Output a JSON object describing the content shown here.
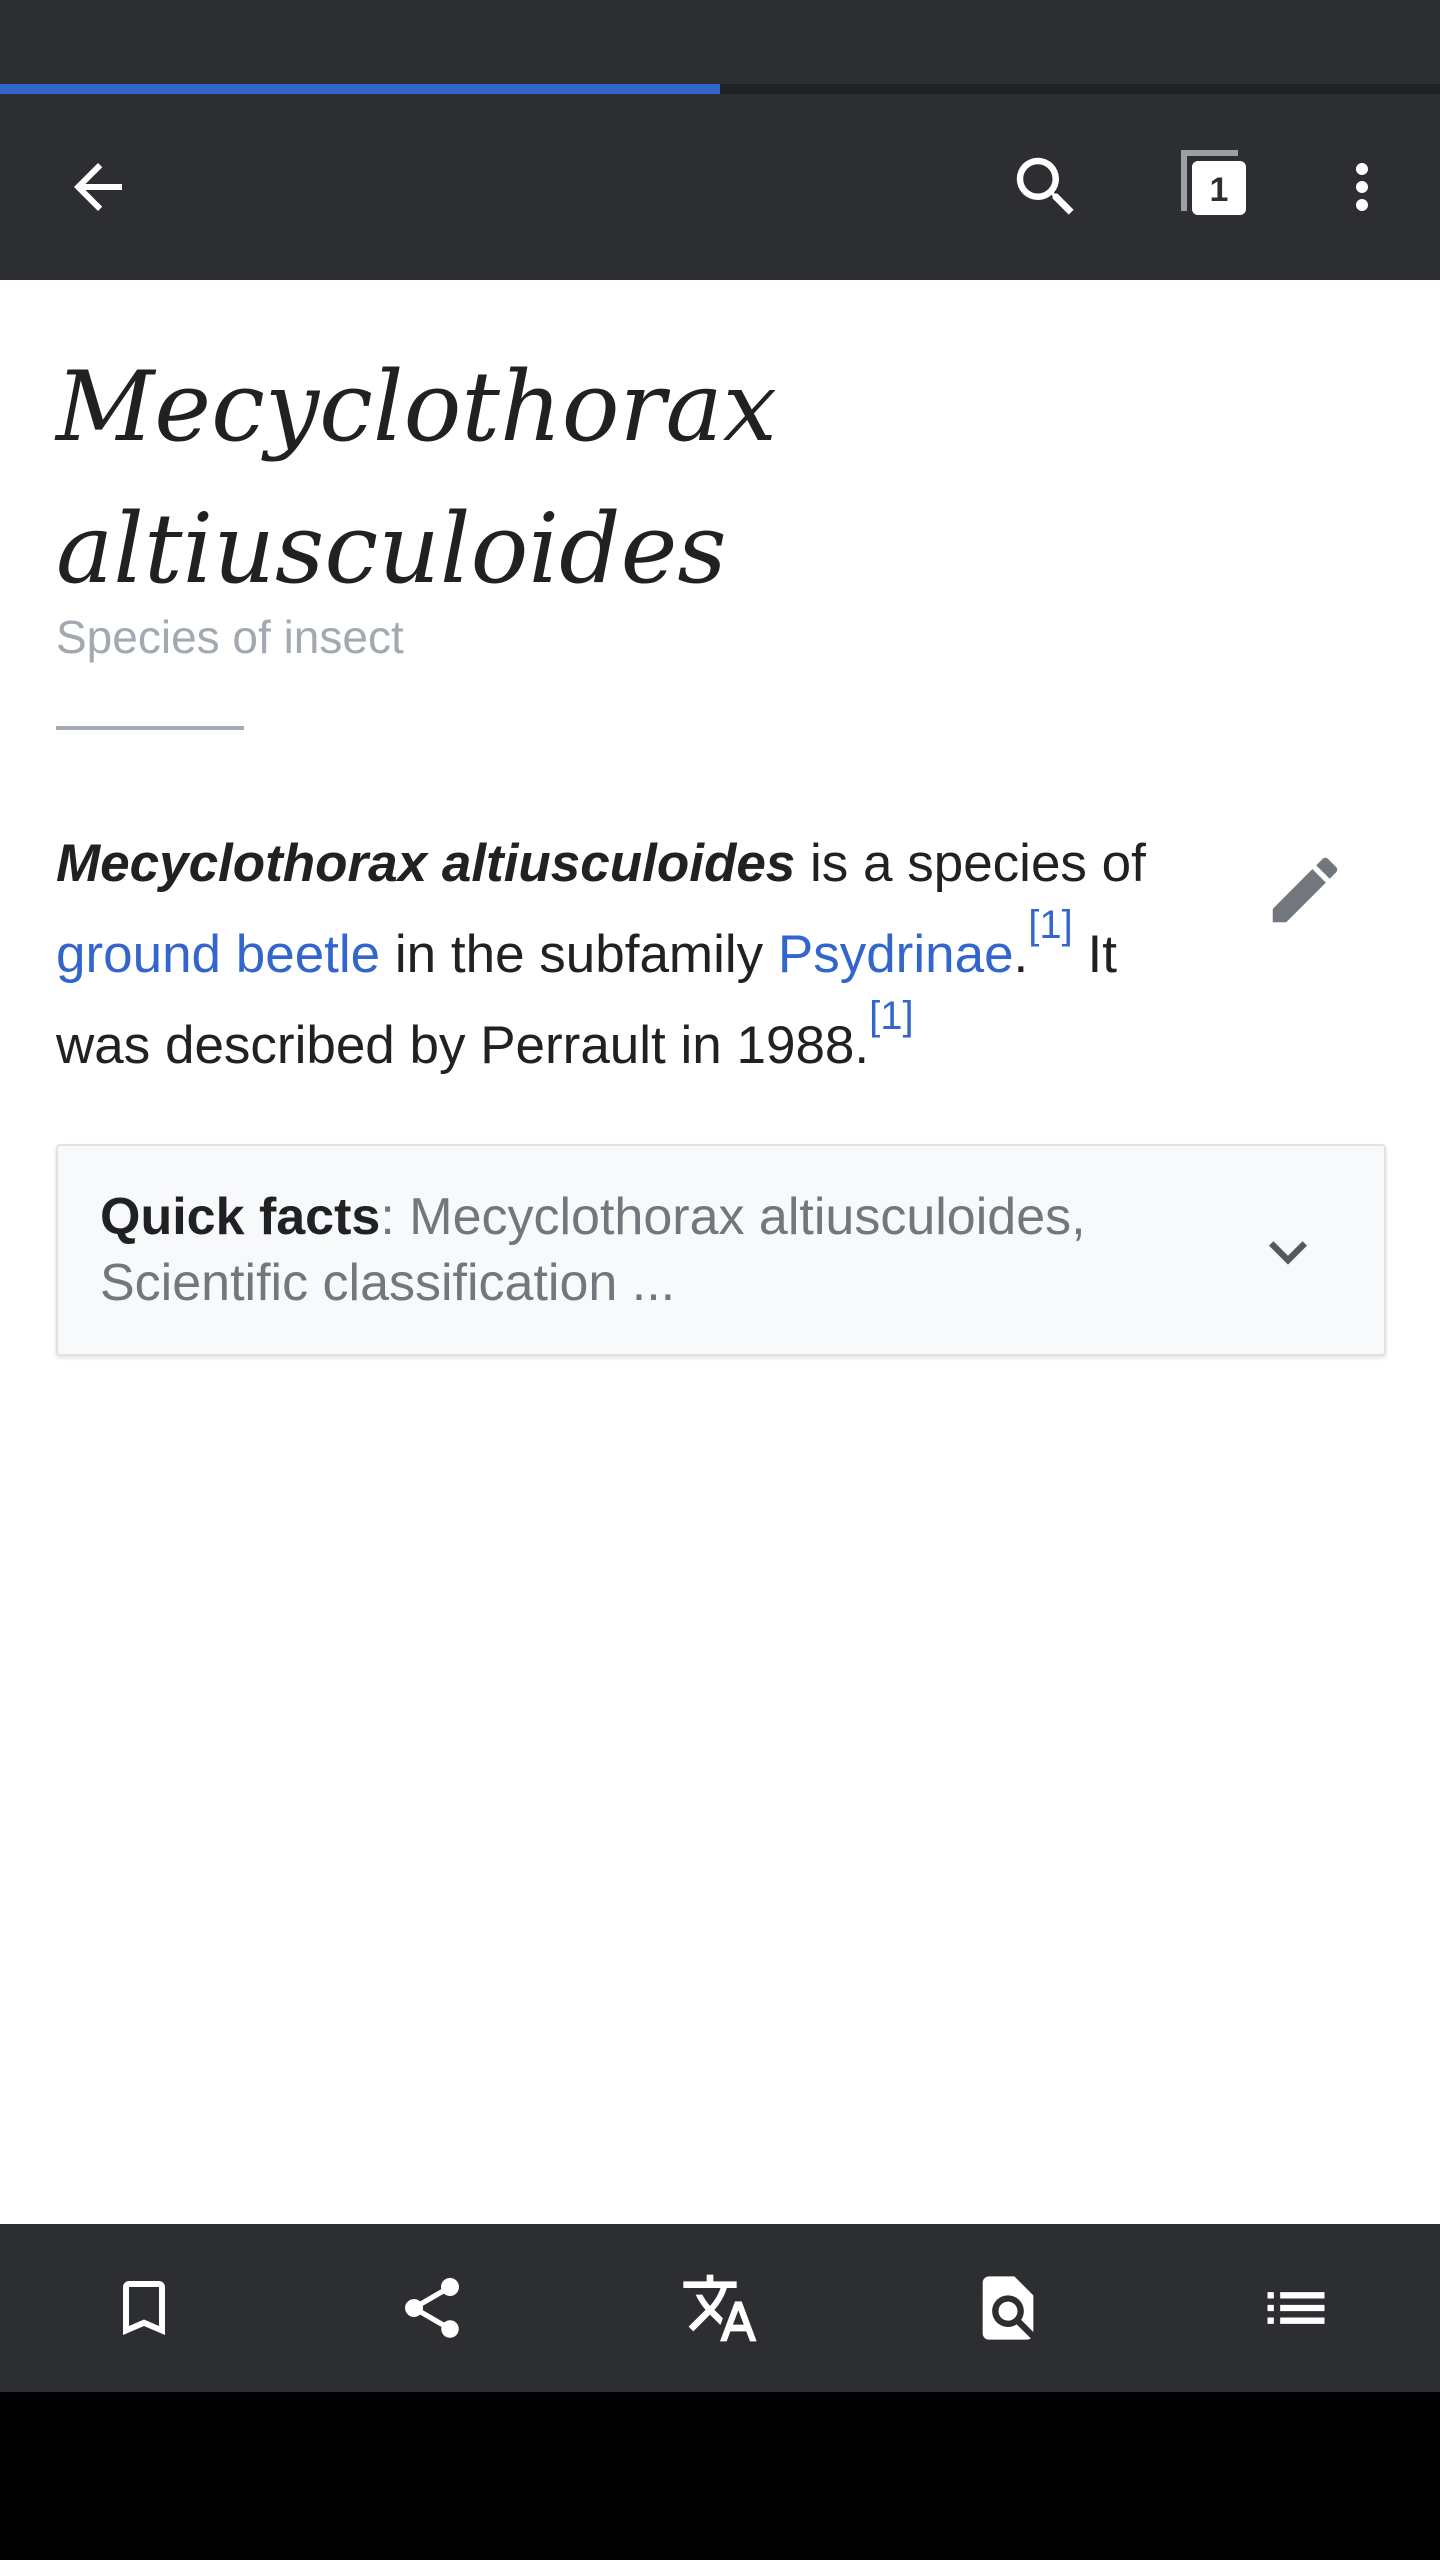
{
  "colors": {
    "toolbar_bg": "#2d2e31",
    "accent_blue": "#3366cc",
    "text": "#202122",
    "muted_text": "#a2a9b1"
  },
  "load_progress": 0.5,
  "toolbar": {
    "back_icon": "arrow-left-icon",
    "search_icon": "search-icon",
    "tabs_icon": "tabs-icon",
    "tabs_count": "1",
    "overflow_icon": "more-vert-icon"
  },
  "article": {
    "title_line1": "Mecyclothorax",
    "title_line2": "altiusculoides",
    "description": "Species of insect",
    "lead": {
      "subject": "Mecyclothorax altiusculoides",
      "text1": " is a species of ",
      "link1": "ground beetle",
      "text2": " in the subfamily ",
      "link2": "Psydrinae",
      "text3": ".",
      "ref1": "[1]",
      "text4": " It was described by Perrault in 1988.",
      "ref2": "[1]"
    },
    "edit_icon": "pencil-icon",
    "quick_facts": {
      "label": "Quick facts",
      "separator": ": ",
      "summary": "Mecyclothorax altiusculoides, Scientific classification ...",
      "icon": "chevron-down-icon"
    }
  },
  "bottom_bar": [
    {
      "icon": "bookmark-icon"
    },
    {
      "icon": "share-icon"
    },
    {
      "icon": "translate-icon"
    },
    {
      "icon": "find-in-page-icon"
    },
    {
      "icon": "contents-icon"
    }
  ]
}
